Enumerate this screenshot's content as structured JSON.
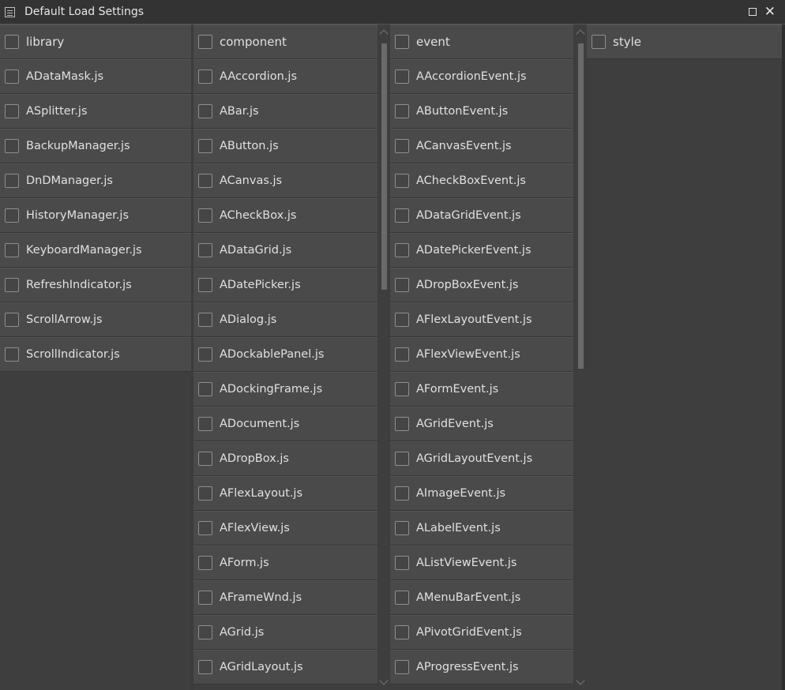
{
  "window": {
    "title": "Default Load Settings",
    "icon": "window-icon"
  },
  "columns": [
    {
      "header": "library",
      "items": [
        "ADataMask.js",
        "ASplitter.js",
        "BackupManager.js",
        "DnDManager.js",
        "HistoryManager.js",
        "KeyboardManager.js",
        "RefreshIndicator.js",
        "ScrollArrow.js",
        "ScrollIndicator.js"
      ]
    },
    {
      "header": "component",
      "items": [
        "AAccordion.js",
        "ABar.js",
        "AButton.js",
        "ACanvas.js",
        "ACheckBox.js",
        "ADataGrid.js",
        "ADatePicker.js",
        "ADialog.js",
        "ADockablePanel.js",
        "ADockingFrame.js",
        "ADocument.js",
        "ADropBox.js",
        "AFlexLayout.js",
        "AFlexView.js",
        "AForm.js",
        "AFrameWnd.js",
        "AGrid.js",
        "AGridLayout.js"
      ]
    },
    {
      "header": "event",
      "items": [
        "AAccordionEvent.js",
        "AButtonEvent.js",
        "ACanvasEvent.js",
        "ACheckBoxEvent.js",
        "ADataGridEvent.js",
        "ADatePickerEvent.js",
        "ADropBoxEvent.js",
        "AFlexLayoutEvent.js",
        "AFlexViewEvent.js",
        "AFormEvent.js",
        "AGridEvent.js",
        "AGridLayoutEvent.js",
        "AImageEvent.js",
        "ALabelEvent.js",
        "AListViewEvent.js",
        "AMenuBarEvent.js",
        "APivotGridEvent.js",
        "AProgressEvent.js"
      ]
    },
    {
      "header": "style",
      "items": []
    }
  ],
  "colors": {
    "background": "#3c3c3c",
    "row": "#4a4a4a",
    "text": "#e0e0e0"
  }
}
